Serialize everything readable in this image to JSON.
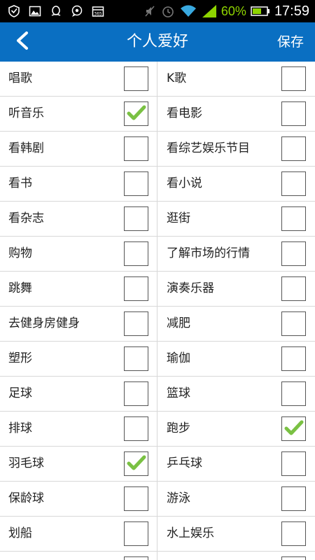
{
  "status_bar": {
    "battery_percent": "60%",
    "time": "17:59",
    "icons": [
      "shield-icon",
      "image-icon",
      "qq-penguin-icon",
      "chat-bubble-icon",
      "calendar-icon",
      "mute-icon",
      "alarm-icon",
      "wifi-icon",
      "signal-icon",
      "battery-icon"
    ],
    "battery_color": "#8ed400"
  },
  "header": {
    "title": "个人爱好",
    "save_label": "保存",
    "background_color": "#0a6fc2"
  },
  "hobbies": [
    {
      "left": {
        "label": "唱歌",
        "checked": false
      },
      "right": {
        "label": "K歌",
        "checked": false
      }
    },
    {
      "left": {
        "label": "听音乐",
        "checked": true
      },
      "right": {
        "label": "看电影",
        "checked": false
      }
    },
    {
      "left": {
        "label": "看韩剧",
        "checked": false
      },
      "right": {
        "label": "看综艺娱乐节目",
        "checked": false
      }
    },
    {
      "left": {
        "label": "看书",
        "checked": false
      },
      "right": {
        "label": "看小说",
        "checked": false
      }
    },
    {
      "left": {
        "label": "看杂志",
        "checked": false
      },
      "right": {
        "label": "逛街",
        "checked": false
      }
    },
    {
      "left": {
        "label": "购物",
        "checked": false
      },
      "right": {
        "label": "了解市场的行情",
        "checked": false
      }
    },
    {
      "left": {
        "label": "跳舞",
        "checked": false
      },
      "right": {
        "label": "演奏乐器",
        "checked": false
      }
    },
    {
      "left": {
        "label": "去健身房健身",
        "checked": false
      },
      "right": {
        "label": "减肥",
        "checked": false
      }
    },
    {
      "left": {
        "label": "塑形",
        "checked": false
      },
      "right": {
        "label": "瑜伽",
        "checked": false
      }
    },
    {
      "left": {
        "label": "足球",
        "checked": false
      },
      "right": {
        "label": "篮球",
        "checked": false
      }
    },
    {
      "left": {
        "label": "排球",
        "checked": false
      },
      "right": {
        "label": "跑步",
        "checked": true
      }
    },
    {
      "left": {
        "label": "羽毛球",
        "checked": true
      },
      "right": {
        "label": "乒乓球",
        "checked": false
      }
    },
    {
      "left": {
        "label": "保龄球",
        "checked": false
      },
      "right": {
        "label": "游泳",
        "checked": false
      }
    },
    {
      "left": {
        "label": "划船",
        "checked": false
      },
      "right": {
        "label": "水上娱乐",
        "checked": false
      }
    },
    {
      "left": {
        "label": "",
        "checked": false
      },
      "right": {
        "label": "",
        "checked": false
      }
    }
  ],
  "check_color": "#7ac143"
}
